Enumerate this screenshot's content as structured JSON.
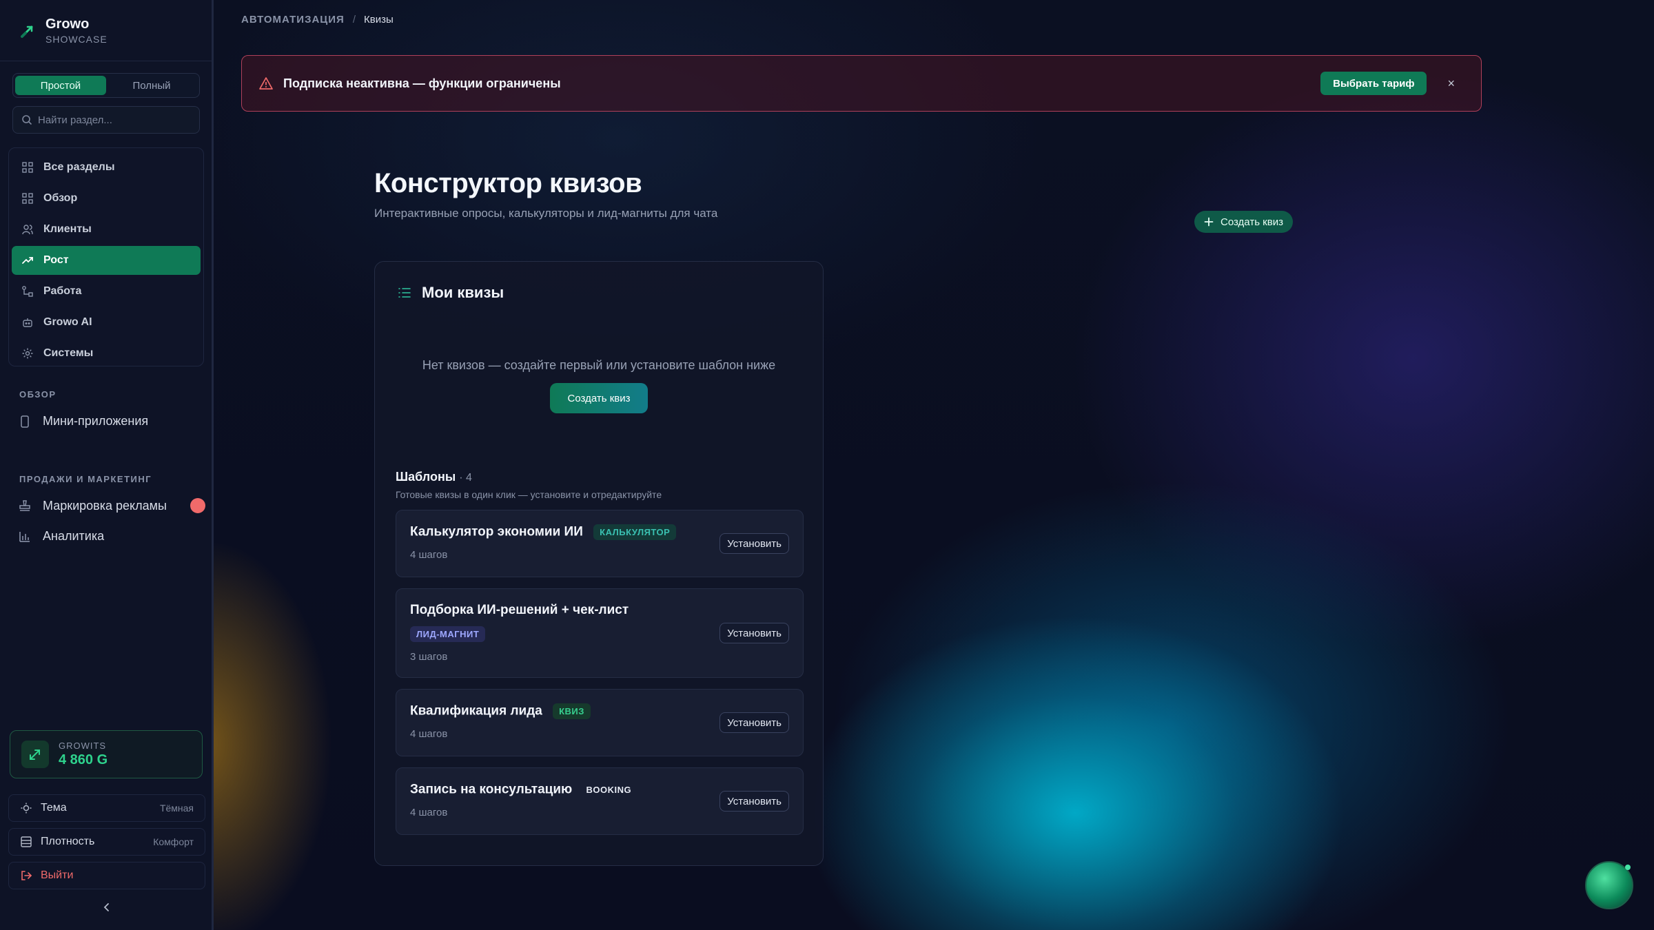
{
  "brand": {
    "name": "Growo",
    "subtitle": "SHOWCASE"
  },
  "mode_toggle": {
    "simple": "Простой",
    "full": "Полный"
  },
  "search": {
    "placeholder": "Найти раздел..."
  },
  "nav": [
    {
      "label": "Все разделы",
      "icon": "grid-icon"
    },
    {
      "label": "Обзор",
      "icon": "grid-icon"
    },
    {
      "label": "Клиенты",
      "icon": "users-icon"
    },
    {
      "label": "Рост",
      "icon": "trending-up-icon",
      "active": true
    },
    {
      "label": "Работа",
      "icon": "workflow-icon"
    },
    {
      "label": "Growo AI",
      "icon": "bot-icon"
    },
    {
      "label": "Системы",
      "icon": "gear-icon"
    }
  ],
  "sections": {
    "overview": {
      "title": "ОБЗОР",
      "items": [
        {
          "label": "Мини-приложения",
          "icon": "phone-icon"
        }
      ]
    },
    "sales": {
      "title": "ПРОДАЖИ И МАРКЕТИНГ",
      "items": [
        {
          "label": "Маркировка рекламы",
          "icon": "stamp-icon"
        },
        {
          "label": "Аналитика",
          "icon": "bar-chart-icon"
        }
      ]
    }
  },
  "growits": {
    "label": "GROWITS",
    "value": "4 860 G"
  },
  "settings": {
    "theme": {
      "label": "Тема",
      "value": "Тёмная"
    },
    "density": {
      "label": "Плотность",
      "value": "Комфорт"
    },
    "logout": {
      "label": "Выйти"
    }
  },
  "breadcrumb": {
    "parent": "АВТОМАТИЗАЦИЯ",
    "sep": "/",
    "current": "Квизы"
  },
  "alert": {
    "text": "Подписка неактивна — функции ограничены",
    "button": "Выбрать тариф",
    "close": "×"
  },
  "page": {
    "title": "Конструктор квизов",
    "subtitle": "Интерактивные опросы, калькуляторы и лид-магниты для чата",
    "create_button": "Создать квиз"
  },
  "quizzes": {
    "title": "Мои квизы",
    "empty": "Нет квизов — создайте первый или установите шаблон ниже",
    "create_button": "Создать квиз"
  },
  "templates": {
    "title": "Шаблоны",
    "count": "· 4",
    "description": "Готовые квизы в один клик — установите и отредактируйте",
    "install_label": "Установить",
    "items": [
      {
        "name": "Калькулятор экономии ИИ",
        "tag": "КАЛЬКУЛЯТОР",
        "steps": "4 шагов"
      },
      {
        "name": "Подборка ИИ-решений + чек-лист",
        "tag": "ЛИД-МАГНИТ",
        "steps": "3 шагов"
      },
      {
        "name": "Квалификация лида",
        "tag": "КВИЗ",
        "steps": "4 шагов"
      },
      {
        "name": "Запись на консультацию",
        "tag": "BOOKING",
        "steps": "4 шагов"
      }
    ]
  },
  "colors": {
    "accent": "#0f7a56",
    "alert_border": "#b0405a",
    "growits_value": "#2ed38d"
  }
}
